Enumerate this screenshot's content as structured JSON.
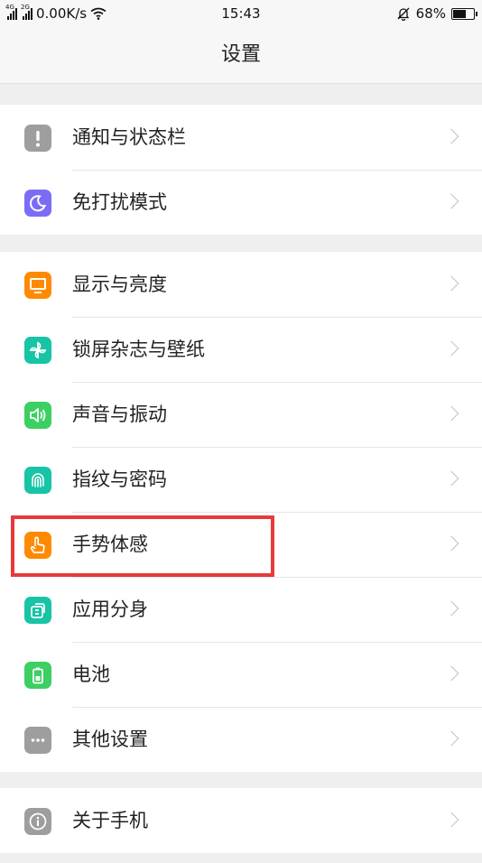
{
  "status_bar": {
    "sim1_network": "4G",
    "sim2_network": "2G",
    "speed": "0.00K/s",
    "time": "15:43",
    "battery": "68%",
    "battery_level": 0.68
  },
  "header": {
    "title": "设置"
  },
  "groups": [
    {
      "items": [
        {
          "label": "通知与状态栏",
          "icon": "notification-icon",
          "color": "#9e9e9e"
        },
        {
          "label": "免打扰模式",
          "icon": "moon-icon",
          "color": "#7b6cf6"
        }
      ]
    },
    {
      "items": [
        {
          "label": "显示与亮度",
          "icon": "display-icon",
          "color": "#ff8a00"
        },
        {
          "label": "锁屏杂志与壁纸",
          "icon": "pinwheel-icon",
          "color": "#17c4a5"
        },
        {
          "label": "声音与振动",
          "icon": "speaker-icon",
          "color": "#3ccf61"
        },
        {
          "label": "指纹与密码",
          "icon": "fingerprint-icon",
          "color": "#17c4a5"
        },
        {
          "label": "手势体感",
          "icon": "gesture-hand-icon",
          "color": "#ff8a00"
        },
        {
          "label": "应用分身",
          "icon": "app-clone-icon",
          "color": "#17c4a5"
        },
        {
          "label": "电池",
          "icon": "battery-icon",
          "color": "#3ccf61"
        },
        {
          "label": "其他设置",
          "icon": "more-icon",
          "color": "#9e9e9e"
        }
      ]
    },
    {
      "items": [
        {
          "label": "关于手机",
          "icon": "info-icon",
          "color": "#9e9e9e"
        }
      ]
    }
  ],
  "highlight": {
    "target": "手势体感",
    "color": "#e83a3a"
  }
}
